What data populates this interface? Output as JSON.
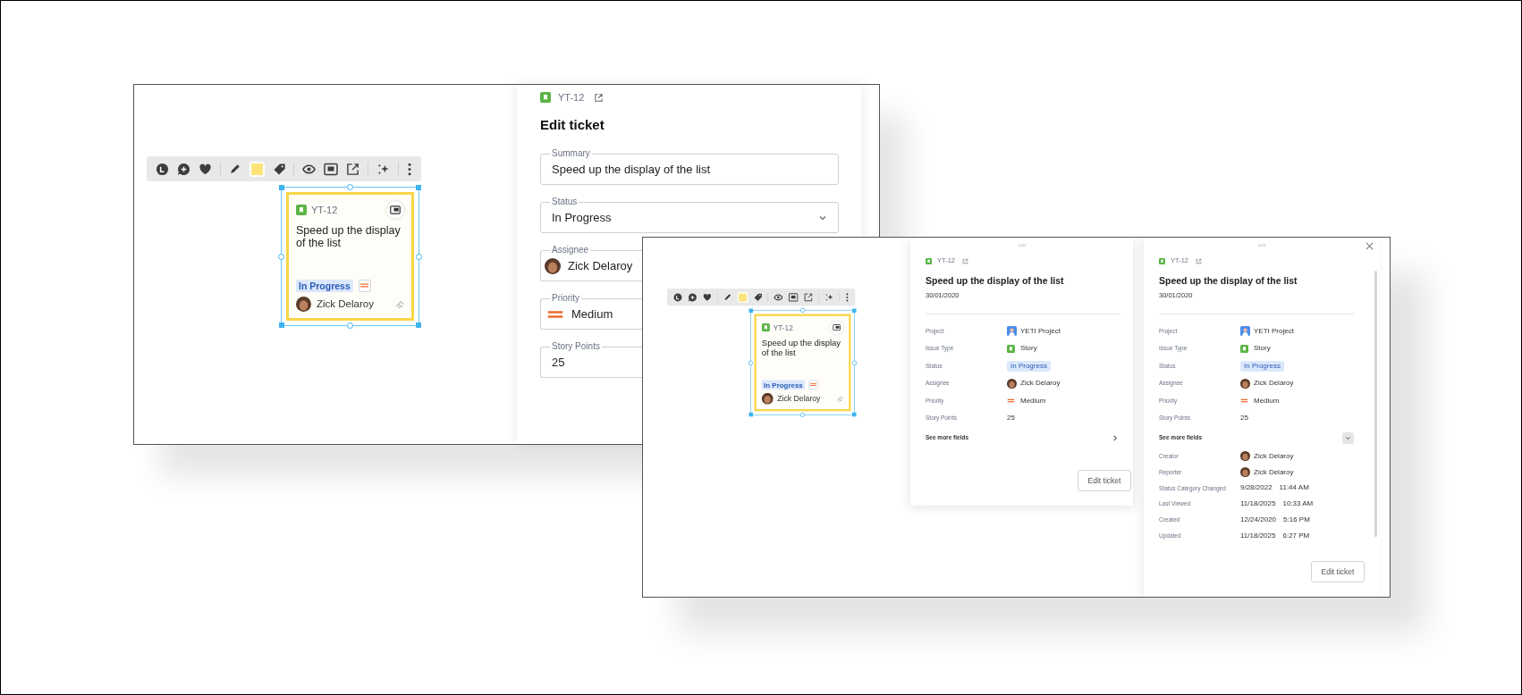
{
  "left_window": {
    "card": {
      "ticket_id": "YT-12",
      "summary": "Speed up the display of the list",
      "status": "In Progress",
      "assignee": "Zick Delaroy"
    },
    "edit_panel": {
      "ticket_id": "YT-12",
      "title": "Edit ticket",
      "fields": [
        {
          "label": "Summary",
          "kind": "text",
          "value": "Speed up the display of the list"
        },
        {
          "label": "Status",
          "kind": "select",
          "value": "In Progress"
        },
        {
          "label": "Assignee",
          "kind": "person",
          "value": "Zick Delaroy"
        },
        {
          "label": "Priority",
          "kind": "priority",
          "value": "Medium"
        },
        {
          "label": "Story Points",
          "kind": "text",
          "value": "25"
        }
      ]
    }
  },
  "right_window": {
    "card": {
      "ticket_id": "YT-12",
      "summary": "Speed up the display of the list",
      "status": "In Progress",
      "assignee": "Zick Delaroy"
    },
    "detail_panels": [
      {
        "ticket_id": "YT-12",
        "title": "Speed up the display of the list",
        "date": "30/01/2020",
        "close_button": false,
        "fields": [
          {
            "label": "Project",
            "kind": "project",
            "value": "YETI Project"
          },
          {
            "label": "Issue Type",
            "kind": "issue_type",
            "value": "Story"
          },
          {
            "label": "Status",
            "kind": "status",
            "value": "In Progress"
          },
          {
            "label": "Assignee",
            "kind": "person",
            "value": "Zick Delaroy"
          },
          {
            "label": "Priority",
            "kind": "priority",
            "value": "Medium"
          },
          {
            "label": "Story Points",
            "kind": "text",
            "value": "25"
          }
        ],
        "see_more": {
          "label": "See more fields",
          "expanded": false
        },
        "button": "Edit ticket"
      },
      {
        "ticket_id": "YT-12",
        "title": "Speed up the display of the list",
        "date": "30/01/2020",
        "close_button": true,
        "fields": [
          {
            "label": "Project",
            "kind": "project",
            "value": "YETI Project"
          },
          {
            "label": "Issue Type",
            "kind": "issue_type",
            "value": "Story"
          },
          {
            "label": "Status",
            "kind": "status",
            "value": "In Progress"
          },
          {
            "label": "Assignee",
            "kind": "person",
            "value": "Zick Delaroy"
          },
          {
            "label": "Priority",
            "kind": "priority",
            "value": "Medium"
          },
          {
            "label": "Story Points",
            "kind": "text",
            "value": "25"
          }
        ],
        "see_more": {
          "label": "See more fields",
          "expanded": true
        },
        "more_fields": [
          {
            "label": "Creator",
            "kind": "person",
            "value": "Zick Delaroy"
          },
          {
            "label": "Reporter",
            "kind": "person",
            "value": "Zick Delaroy"
          },
          {
            "label": "Status Category Changed",
            "kind": "datetime",
            "date": "9/28/2022",
            "time": "11:44 AM"
          },
          {
            "label": "Last Viewed",
            "kind": "datetime",
            "date": "11/18/2025",
            "time": "10:33 AM"
          },
          {
            "label": "Created",
            "kind": "datetime",
            "date": "12/24/2020",
            "time": "5:16 PM"
          },
          {
            "label": "Updated",
            "kind": "datetime",
            "date": "11/18/2025",
            "time": "6:27 PM"
          }
        ],
        "button": "Edit ticket"
      }
    ]
  }
}
